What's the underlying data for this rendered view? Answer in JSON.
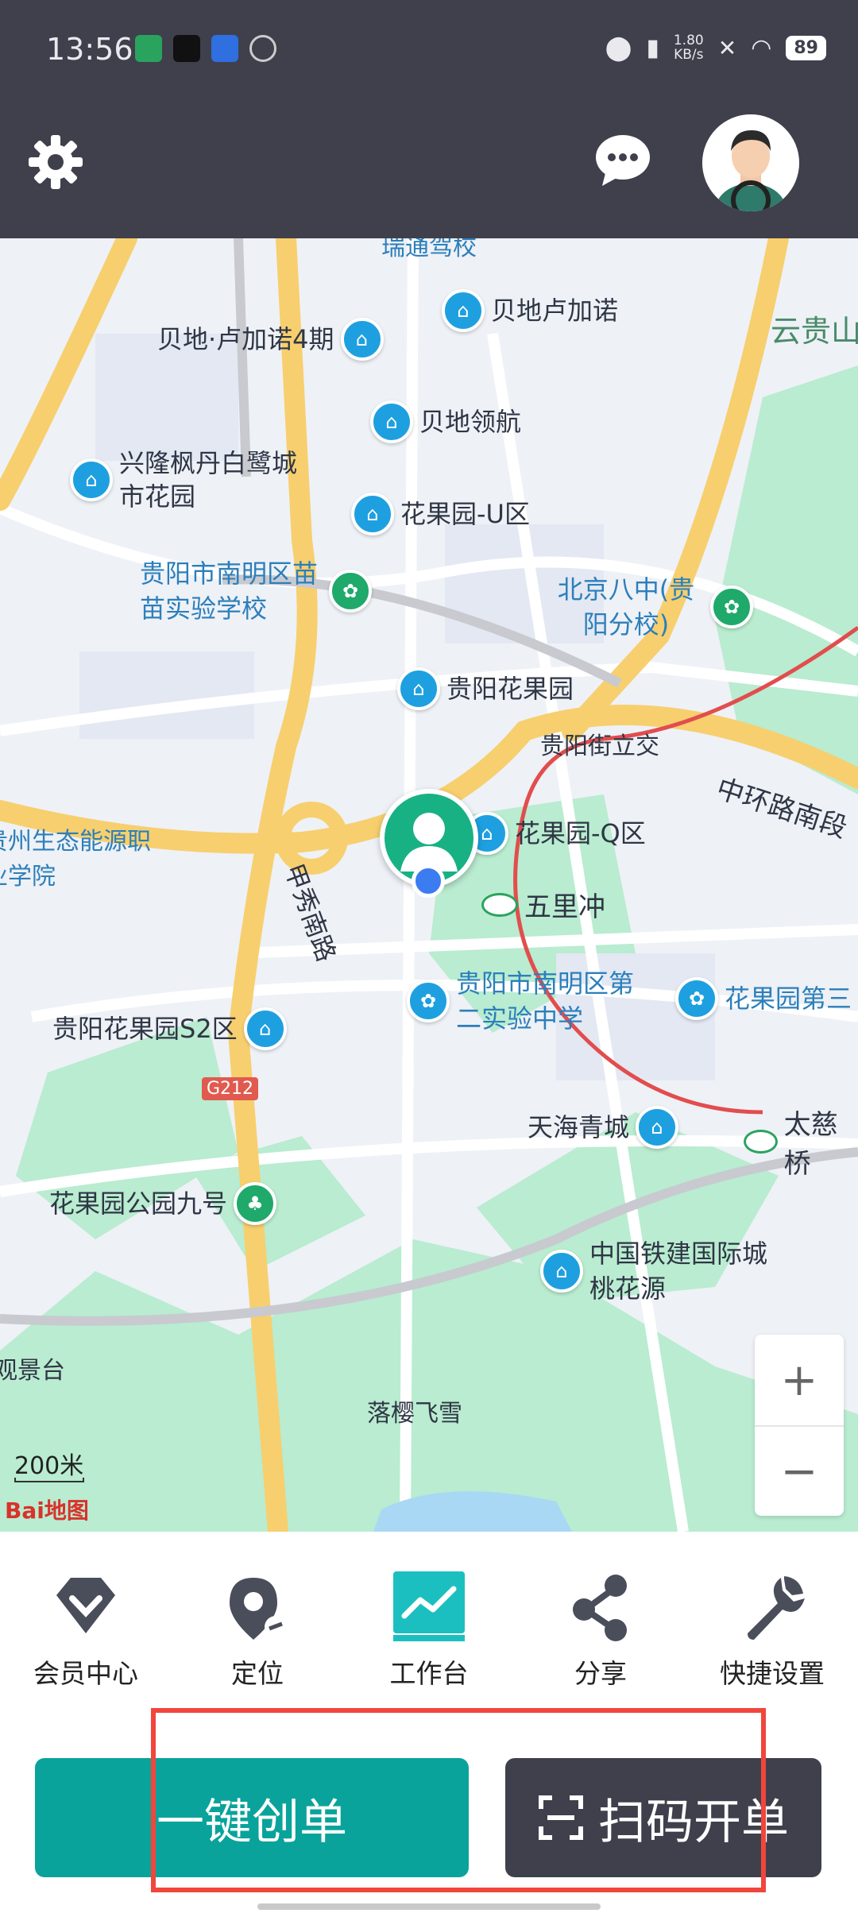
{
  "status_bar": {
    "time": "13:56",
    "net_speed": "1.80",
    "net_unit": "KB/s",
    "battery": "89"
  },
  "map": {
    "pois": [
      {
        "name": "贝地卢加诺"
      },
      {
        "name": "贝地·卢加诺4期"
      },
      {
        "name": "贝地领航"
      },
      {
        "name": "兴隆枫丹白鹭城市花园"
      },
      {
        "name": "花果园-U区"
      },
      {
        "name": "贵阳市南明区苗苗实验学校"
      },
      {
        "name": "北京八中(贵阳分校)"
      },
      {
        "name": "贵阳花果园"
      },
      {
        "name": "花果园-Q区"
      },
      {
        "name": "贵阳市南明区第二实验中学"
      },
      {
        "name": "花果园第三"
      },
      {
        "name": "贵阳花果园S2区"
      },
      {
        "name": "天海青城"
      },
      {
        "name": "花果园公园九号"
      },
      {
        "name": "中国铁建国际城桃花源"
      }
    ],
    "labels": {
      "road1": "贵阳街立交",
      "road2": "中环路南段",
      "road3": "甲秀南路",
      "metro1": "五里冲",
      "metro2": "太慈桥",
      "school": "贵州生态能源职业学院",
      "yun": "云贵山",
      "view": "观景台",
      "luoying": "落樱飞雪",
      "highway": "G212",
      "top": "瑞通驾校"
    },
    "zoom_in": "+",
    "zoom_out": "−",
    "scale": "200米",
    "logo": "Bai地图"
  },
  "toolbar": {
    "items": [
      {
        "label": "会员中心",
        "icon": "diamond-icon"
      },
      {
        "label": "定位",
        "icon": "location-pin-icon"
      },
      {
        "label": "工作台",
        "icon": "chart-board-icon"
      },
      {
        "label": "分享",
        "icon": "share-icon"
      },
      {
        "label": "快捷设置",
        "icon": "wrench-icon"
      }
    ]
  },
  "actions": {
    "create_order": "一键创单",
    "scan_order": "扫码开单"
  },
  "colors": {
    "header": "#3f404c",
    "primary": "#0aa39b",
    "highlight": "#f0463c"
  }
}
